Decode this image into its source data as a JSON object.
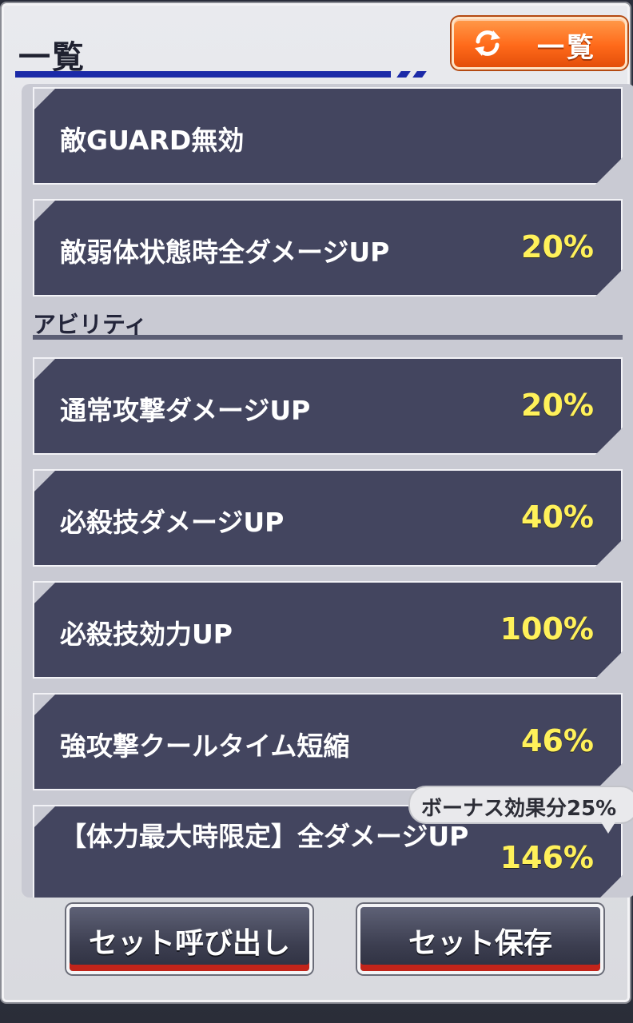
{
  "header": {
    "title": "一覧",
    "list_button_label": "一覧"
  },
  "items_top": [
    {
      "name": "敵GUARD無効",
      "value": ""
    },
    {
      "name": "敵弱体状態時全ダメージUP",
      "value": "20%"
    }
  ],
  "section": {
    "label": "アビリティ"
  },
  "abilities": [
    {
      "name": "通常攻撃ダメージUP",
      "value": "20%"
    },
    {
      "name": "必殺技ダメージUP",
      "value": "40%"
    },
    {
      "name": "必殺技効力UP",
      "value": "100%"
    },
    {
      "name": "強攻撃クールタイム短縮",
      "value": "46%"
    },
    {
      "name": "【体力最大時限定】全ダメージUP",
      "value": "146%"
    }
  ],
  "bonus_tooltip": "ボーナス効果分25%",
  "footer": {
    "load_set_label": "セット呼び出し",
    "save_set_label": "セット保存"
  },
  "colors": {
    "card_bg": "#43455f",
    "value_text": "#fff15a",
    "accent_orange": "#ff6a1a",
    "title_underline": "#1b2aa8"
  }
}
